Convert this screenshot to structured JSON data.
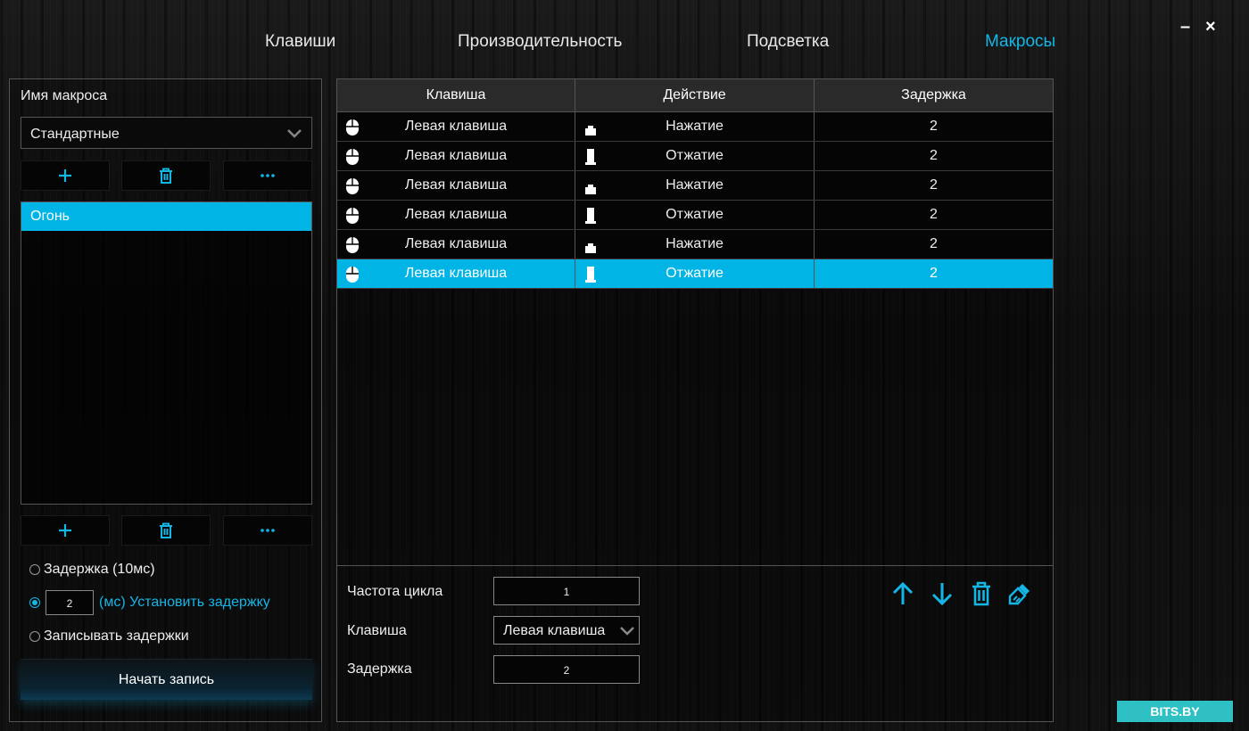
{
  "window": {
    "minimize_label": "–",
    "close_label": "×"
  },
  "tabs": [
    {
      "label": "Клавиши",
      "active": false
    },
    {
      "label": "Производительность",
      "active": false
    },
    {
      "label": "Подсветка",
      "active": false
    },
    {
      "label": "Макросы",
      "active": true
    }
  ],
  "left": {
    "title": "Имя макроса",
    "profile_select": "Стандартные",
    "macros": [
      "Огонь"
    ],
    "delay_options": {
      "fixed_label": "Задержка (10мс)",
      "custom_value": "2",
      "custom_label": "(мс) Установить задержку",
      "record_label": "Записывать задержки",
      "selected": "custom"
    },
    "record_button": "Начать запись"
  },
  "table": {
    "headers": [
      "Клавиша",
      "Действие",
      "Задержка"
    ],
    "rows": [
      {
        "key": "Левая клавиша",
        "action": "Нажатие",
        "action_icon": "key-down-icon",
        "delay": "2",
        "selected": false
      },
      {
        "key": "Левая клавиша",
        "action": "Отжатие",
        "action_icon": "key-up-icon",
        "delay": "2",
        "selected": false
      },
      {
        "key": "Левая клавиша",
        "action": "Нажатие",
        "action_icon": "key-down-icon",
        "delay": "2",
        "selected": false
      },
      {
        "key": "Левая клавиша",
        "action": "Отжатие",
        "action_icon": "key-up-icon",
        "delay": "2",
        "selected": false
      },
      {
        "key": "Левая клавиша",
        "action": "Нажатие",
        "action_icon": "key-down-icon",
        "delay": "2",
        "selected": false
      },
      {
        "key": "Левая клавиша",
        "action": "Отжатие",
        "action_icon": "key-up-icon",
        "delay": "2",
        "selected": true
      }
    ]
  },
  "editor": {
    "cycle_label": "Частота цикла",
    "cycle_value": "1",
    "key_label": "Клавиша",
    "key_value": "Левая клавиша",
    "delay_label": "Задержка",
    "delay_value": "2"
  },
  "watermark": "BITS.BY",
  "colors": {
    "accent": "#14b6e6",
    "selection": "#00b4e6"
  }
}
